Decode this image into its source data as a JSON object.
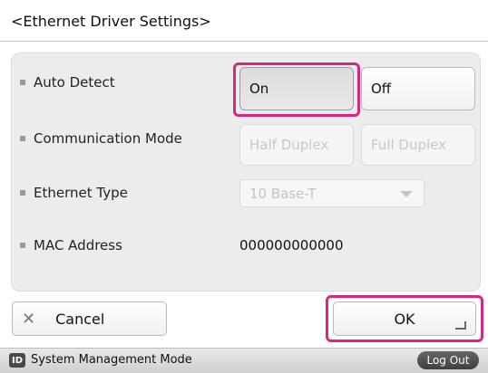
{
  "title": "<Ethernet Driver Settings>",
  "colors": {
    "highlight": "#d6287f",
    "panel": "#ececec"
  },
  "settings": {
    "auto_detect": {
      "label": "Auto Detect",
      "options": [
        "On",
        "Off"
      ],
      "selected": "On"
    },
    "communication_mode": {
      "label": "Communication Mode",
      "options": [
        "Half Duplex",
        "Full Duplex"
      ],
      "enabled": false
    },
    "ethernet_type": {
      "label": "Ethernet Type",
      "value": "10 Base-T",
      "enabled": false
    },
    "mac_address": {
      "label": "MAC Address",
      "value": "000000000000"
    }
  },
  "footer": {
    "cancel_label": "Cancel",
    "cancel_icon": "close-icon",
    "ok_label": "OK",
    "ok_icon": "enter-icon"
  },
  "statusbar": {
    "mode_icon": "ID",
    "mode_text": "System Management Mode",
    "logout_label": "Log Out"
  }
}
